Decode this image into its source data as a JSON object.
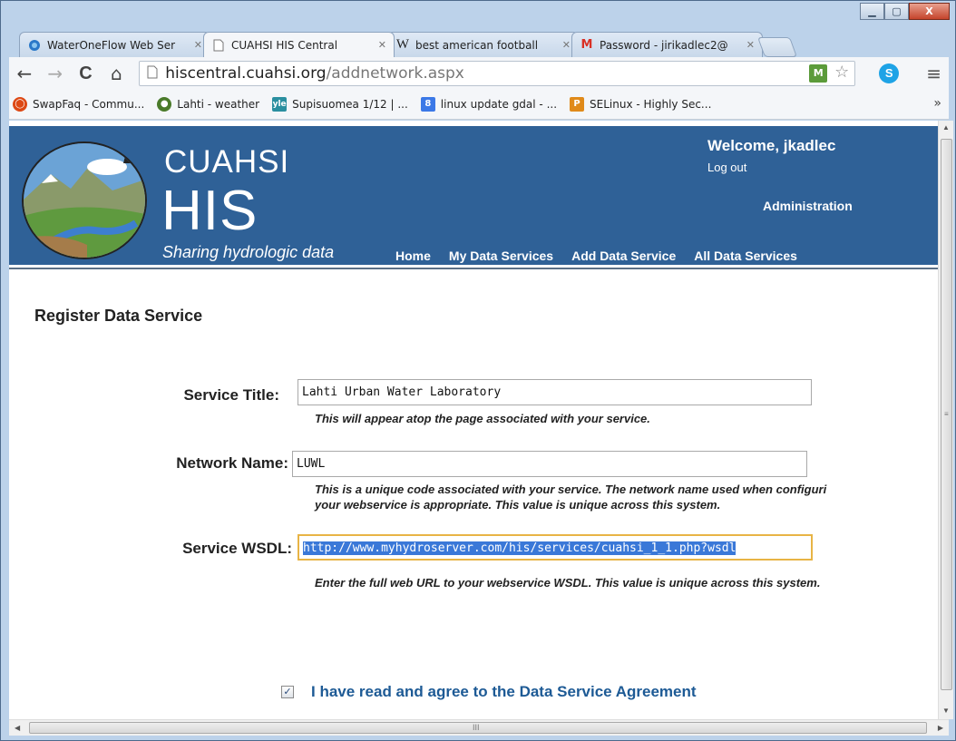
{
  "window": {
    "controls": {
      "minimize": "▁",
      "maximize": "▢",
      "close": "X"
    }
  },
  "tabs": [
    {
      "title": "WaterOneFlow Web Ser",
      "icon": "waterflow-icon",
      "close": "✕",
      "active": false
    },
    {
      "title": "CUAHSI HIS Central",
      "icon": "page-icon",
      "close": "✕",
      "active": true
    },
    {
      "title": "best american football",
      "icon": "wikipedia-icon",
      "close": "✕",
      "active": false
    },
    {
      "title": "Password - jirikadlec2@",
      "icon": "gmail-icon",
      "close": "✕",
      "active": false
    }
  ],
  "toolbar": {
    "back": "←",
    "forward": "→",
    "reload": "C",
    "home": "⌂",
    "url_host": "hiscentral.cuahsi.org",
    "url_path": "/addnetwork.aspx",
    "menu": "≡"
  },
  "bookmarks": [
    {
      "label": "SwapFaq - Commu...",
      "icon": "ubuntu-icon",
      "color": "#dd4814"
    },
    {
      "label": "Lahti - weather",
      "icon": "globe-icon",
      "color": "#4a7a2a"
    },
    {
      "label": "Supisuomea 1/12 | ...",
      "icon": "yle-icon",
      "color": "#2a8fa0"
    },
    {
      "label": "linux update gdal - ...",
      "icon": "google-icon",
      "color": "#3b78e7"
    },
    {
      "label": "SELinux - Highly Sec...",
      "icon": "p-icon",
      "color": "#e08a1a"
    }
  ],
  "bookmarks_more": "»",
  "site": {
    "brand_top": "CUAHSI",
    "brand_main": "HIS",
    "tagline": "Sharing hydrologic data",
    "welcome": "Welcome, jkadlec",
    "logout": "Log out",
    "admin": "Administration",
    "nav": [
      "Home",
      "My Data Services",
      "Add Data Service",
      "All Data Services"
    ],
    "colors": {
      "header": "#2f6197"
    }
  },
  "form": {
    "title": "Register Data Service",
    "service_title": {
      "label": "Service Title:",
      "value": "Lahti Urban Water Laboratory",
      "help": "This will appear atop the page associated with your service."
    },
    "network_name": {
      "label": "Network Name:",
      "value": "LUWL",
      "help_line1": "This is a unique code associated with your service. The network name used when configuri",
      "help_line2": "your webservice is appropriate. This value is unique across this system."
    },
    "service_wsdl": {
      "label": "Service WSDL:",
      "value": "http://www.myhydroserver.com/his/services/cuahsi_1_1.php?wsdl",
      "help": "Enter the full web URL to your webservice WSDL. This value is unique across this system."
    },
    "agree": {
      "checked": true,
      "check_mark": "✓",
      "label": "I have read and agree to the Data Service Agreement"
    }
  },
  "scrollbar": {
    "grip": "≡",
    "up": "▲",
    "down": "▼",
    "left": "◀",
    "right": "▶",
    "hgrip": "III"
  }
}
